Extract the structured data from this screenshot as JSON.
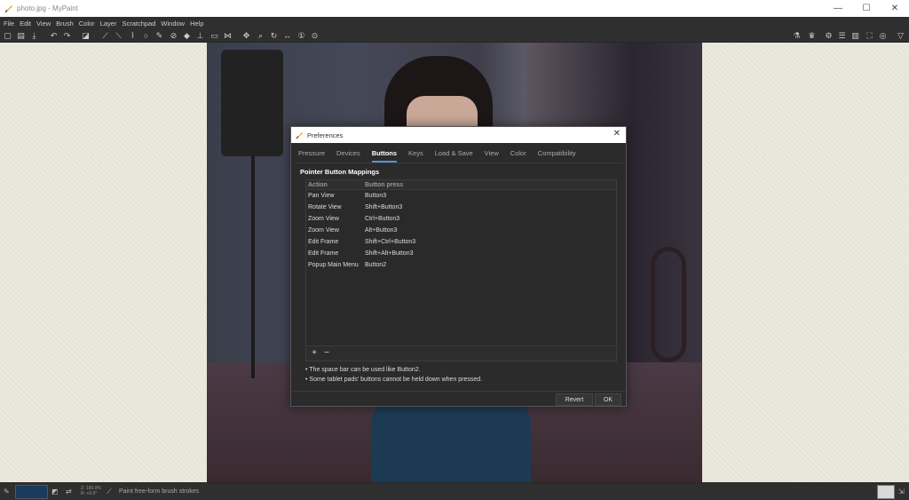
{
  "window": {
    "title": "photo.jpg - MyPaint",
    "minimize": "—",
    "maximize": "☐",
    "close": "✕"
  },
  "menu": [
    "File",
    "Edit",
    "View",
    "Brush",
    "Color",
    "Layer",
    "Scratchpad",
    "Window",
    "Help"
  ],
  "dialog": {
    "title": "Preferences",
    "close": "✕",
    "tabs": [
      "Pressure",
      "Devices",
      "Buttons",
      "Keys",
      "Load & Save",
      "View",
      "Color",
      "Compatibility"
    ],
    "active_tab": "Buttons",
    "section_title": "Pointer Button Mappings",
    "columns": {
      "action": "Action",
      "button_press": "Button press"
    },
    "rows": [
      {
        "action": "Pan View",
        "button": "Button3"
      },
      {
        "action": "Rotate View",
        "button": "Shift+Button3"
      },
      {
        "action": "Zoom View",
        "button": "Ctrl+Button3"
      },
      {
        "action": "Zoom View",
        "button": "Alt+Button3"
      },
      {
        "action": "Edit Frame",
        "button": "Shift+Ctrl+Button3"
      },
      {
        "action": "Edit Frame",
        "button": "Shift+Alt+Button3"
      },
      {
        "action": "Popup Main Menu",
        "button": "Button2"
      }
    ],
    "add": "+",
    "remove": "−",
    "hints": [
      "• The space bar can be used like Button2.",
      "• Some tablet pads' buttons cannot be held down when pressed."
    ],
    "revert": "Revert",
    "ok": "OK"
  },
  "status": {
    "zoom_line1": "Z: 100.0%",
    "zoom_line2": "R: +0.0°",
    "message": "Paint free-form brush strokes",
    "color": "#1b3a5e"
  }
}
